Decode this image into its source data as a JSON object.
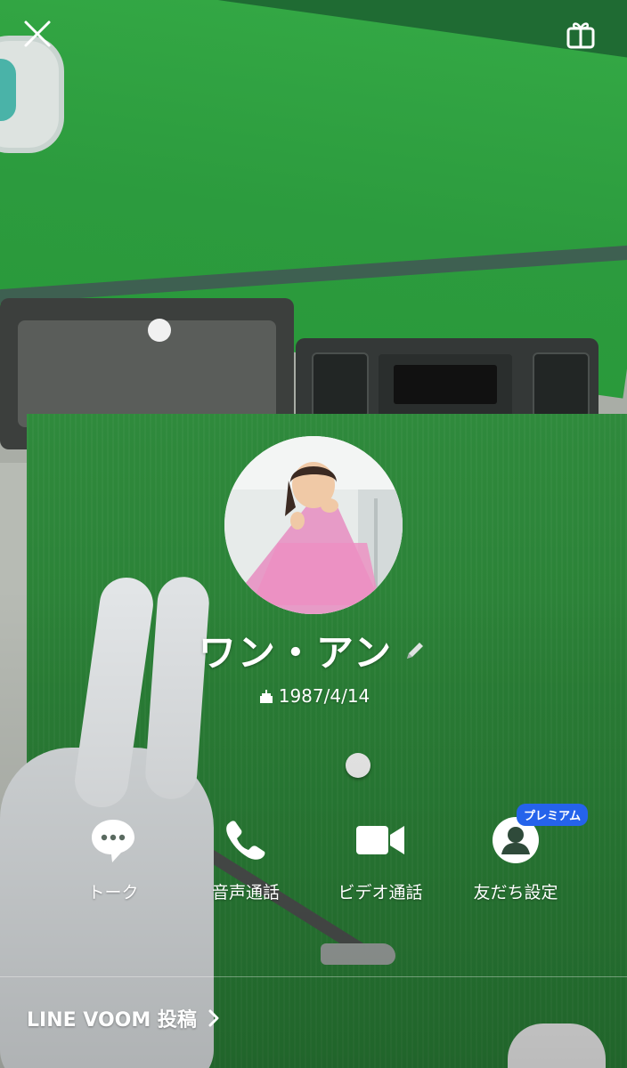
{
  "profile": {
    "name": "ワン・アン",
    "birthday": "1987/4/14"
  },
  "actions": [
    {
      "label": "トーク",
      "icon": "chat-bubble-icon"
    },
    {
      "label": "音声通話",
      "icon": "phone-icon"
    },
    {
      "label": "ビデオ通話",
      "icon": "video-camera-icon"
    },
    {
      "label": "友だち設定",
      "icon": "person-icon"
    }
  ],
  "badge": {
    "premium": "プレミアム"
  },
  "footer": {
    "voom_link": "LINE VOOM 投稿"
  },
  "header": {
    "close_icon": "close-icon",
    "gift_icon": "gift-icon"
  },
  "colors": {
    "text": "#ffffff",
    "premium_badge": "#2563eb"
  }
}
